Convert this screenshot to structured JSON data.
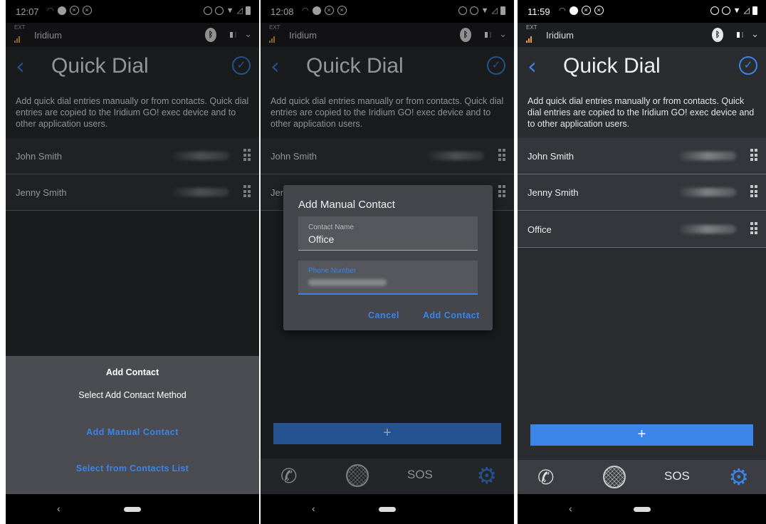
{
  "colors": {
    "accent": "#3b84e8",
    "background": "#2a2c30",
    "row": "#34363b",
    "signal": "#e8a33a"
  },
  "icons": [
    "back-chevron-icon",
    "check-circle-icon",
    "bluetooth-icon",
    "drag-handle-icon",
    "phone-icon",
    "globe-icon",
    "gear-icon",
    "plus-icon"
  ],
  "screens": [
    {
      "status_time": "12:07",
      "network_tag": "EXT",
      "network_name": "Iridium",
      "title": "Quick Dial",
      "description": "Add quick dial entries manually or from contacts. Quick dial entries are copied to the Iridium GO! exec device and to other application users.",
      "entries": [
        {
          "name": "John Smith"
        },
        {
          "name": "Jenny Smith"
        }
      ],
      "sheet": {
        "title": "Add Contact",
        "subtitle": "Select Add Contact Method",
        "option_manual": "Add Manual Contact",
        "option_contacts": "Select from Contacts List"
      }
    },
    {
      "status_time": "12:08",
      "network_tag": "EXT",
      "network_name": "Iridium",
      "title": "Quick Dial",
      "description": "Add quick dial entries manually or from contacts. Quick dial entries are copied to the Iridium GO! exec device and to other application users.",
      "entries": [
        {
          "name": "John Smith"
        },
        {
          "name": "Jer"
        }
      ],
      "add_label": "+",
      "nav": {
        "sos": "SOS"
      },
      "dialog": {
        "title": "Add Manual Contact",
        "name_label": "Contact Name",
        "name_value": "Office",
        "phone_label": "Phone Number",
        "cancel": "Cancel",
        "confirm": "Add Contact"
      }
    },
    {
      "status_time": "11:59",
      "network_tag": "EXT",
      "network_name": "Iridium",
      "title": "Quick Dial",
      "description": "Add quick dial entries manually or from contacts. Quick dial entries are copied to the Iridium GO! exec device and to other application users.",
      "entries": [
        {
          "name": "John Smith"
        },
        {
          "name": "Jenny Smith"
        },
        {
          "name": "Office"
        }
      ],
      "add_label": "+",
      "nav": {
        "sos": "SOS"
      }
    }
  ]
}
